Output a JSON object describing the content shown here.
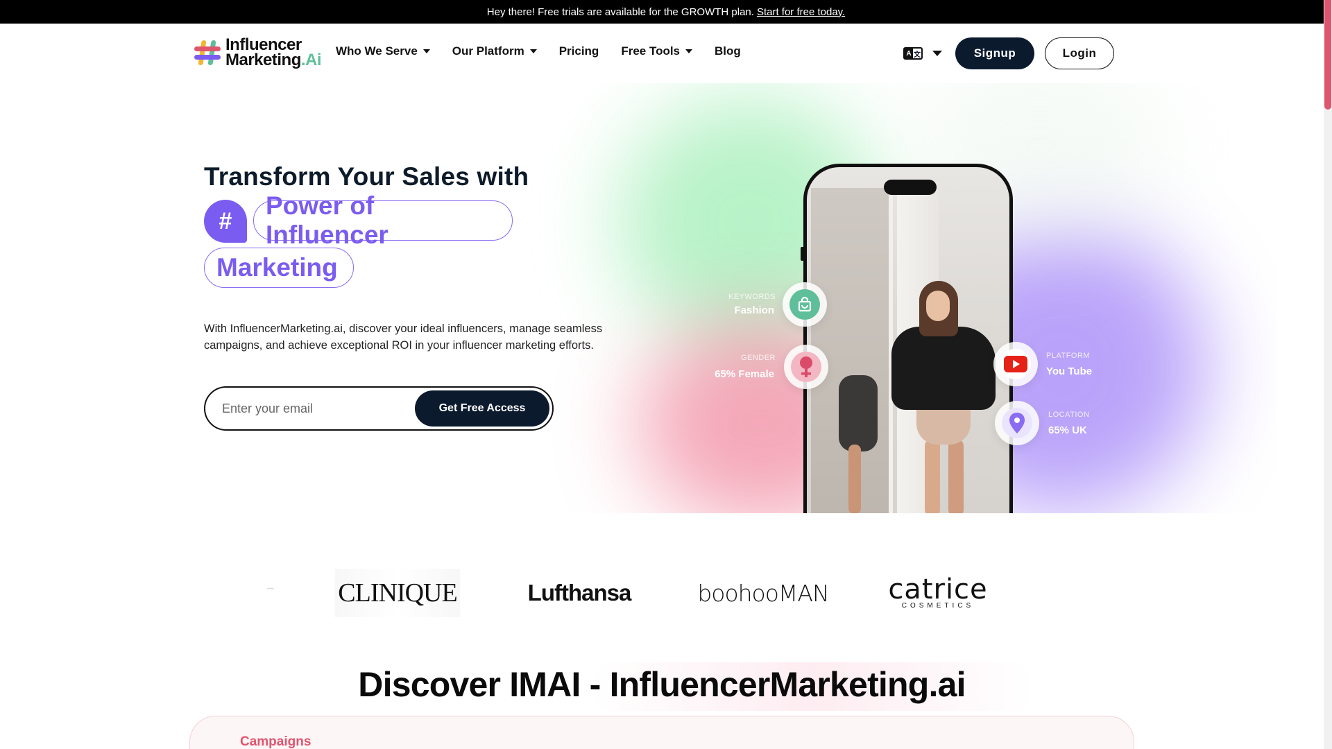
{
  "announcement": {
    "text": "Hey there! Free trials are available for the GROWTH plan.",
    "link": "Start for free today."
  },
  "header": {
    "logo_line1": "Influencer",
    "logo_line2": "Marketing",
    "logo_ai": ".Ai",
    "nav": [
      {
        "label": "Who We Serve",
        "dropdown": true
      },
      {
        "label": "Our Platform",
        "dropdown": true
      },
      {
        "label": "Pricing",
        "dropdown": false
      },
      {
        "label": "Free Tools",
        "dropdown": true
      },
      {
        "label": "Blog",
        "dropdown": false
      }
    ],
    "language_icon": "translate-icon",
    "signup": "Signup",
    "login": "Login"
  },
  "hero": {
    "title": "Transform Your Sales with",
    "hash": "#",
    "pill1": "Power of Influencer",
    "pill2": "Marketing",
    "description": "With InfluencerMarketing.ai, discover your ideal influencers, manage seamless campaigns, and achieve exceptional ROI in your influencer marketing efforts.",
    "email_placeholder": "Enter your email",
    "cta": "Get Free Access",
    "stats": {
      "keywords_label": "KEYWORDS",
      "keywords_value": "Fashion",
      "gender_label": "GENDER",
      "gender_value": "65% Female",
      "platform_label": "PLATFORM",
      "platform_value": "You Tube",
      "location_label": "LOCATION",
      "location_value": "65% UK"
    }
  },
  "brands": [
    "CLINIQUE",
    "Lufthansa",
    "boohooMAN",
    "catrice",
    "COSMETICS"
  ],
  "discover": {
    "title": "Discover IMAI - InfluencerMarketing.ai",
    "panel_label": "Campaigns"
  },
  "colors": {
    "accent_purple": "#7b5cf0",
    "dark_navy": "#0c1a2e",
    "pink": "#e0556e",
    "teal": "#5fbf9a"
  }
}
